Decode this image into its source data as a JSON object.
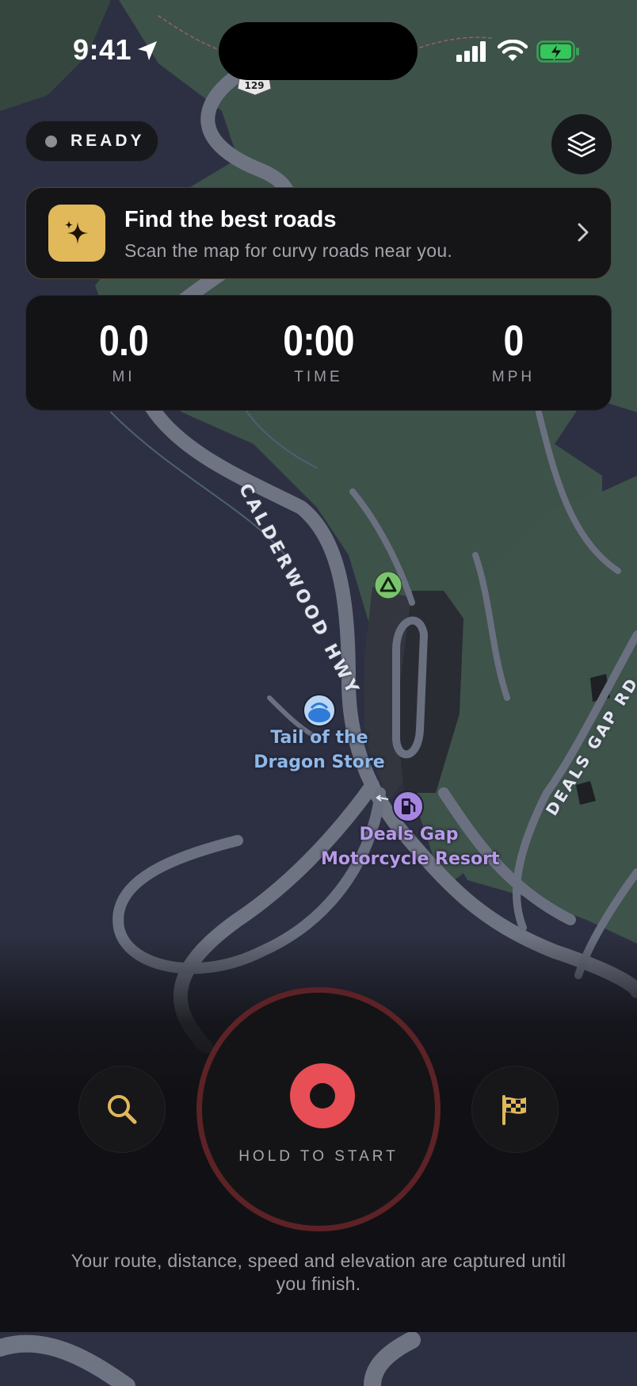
{
  "status_bar": {
    "time": "9:41"
  },
  "status": {
    "label": "READY"
  },
  "promo": {
    "title": "Find the best roads",
    "subtitle": "Scan the map for curvy roads near you."
  },
  "stats": [
    {
      "value": "0.0",
      "label": "MI"
    },
    {
      "value": "0:00",
      "label": "TIME"
    },
    {
      "value": "0",
      "label": "MPH"
    }
  ],
  "map": {
    "route_shield": "129",
    "roads": {
      "calderwood": "CALDERWOOD HWY",
      "deals_gap": "DEALS GAP RD"
    },
    "pois": {
      "store": {
        "line1": "Tail of the",
        "line2": "Dragon Store",
        "color": "#8fb8e8"
      },
      "resort": {
        "line1": "Deals Gap",
        "line2": "Motorcycle Resort",
        "color": "#b89ae8"
      }
    }
  },
  "controls": {
    "search_icon": "search-icon",
    "record_label": "HOLD TO START",
    "finish_icon": "checkered-flag-icon"
  },
  "footer": {
    "note": "Your route, distance, speed and elevation are captured until you finish."
  },
  "colors": {
    "accent_gold": "#e1b85a",
    "record_red": "#e84e55",
    "battery_green": "#34c759"
  }
}
